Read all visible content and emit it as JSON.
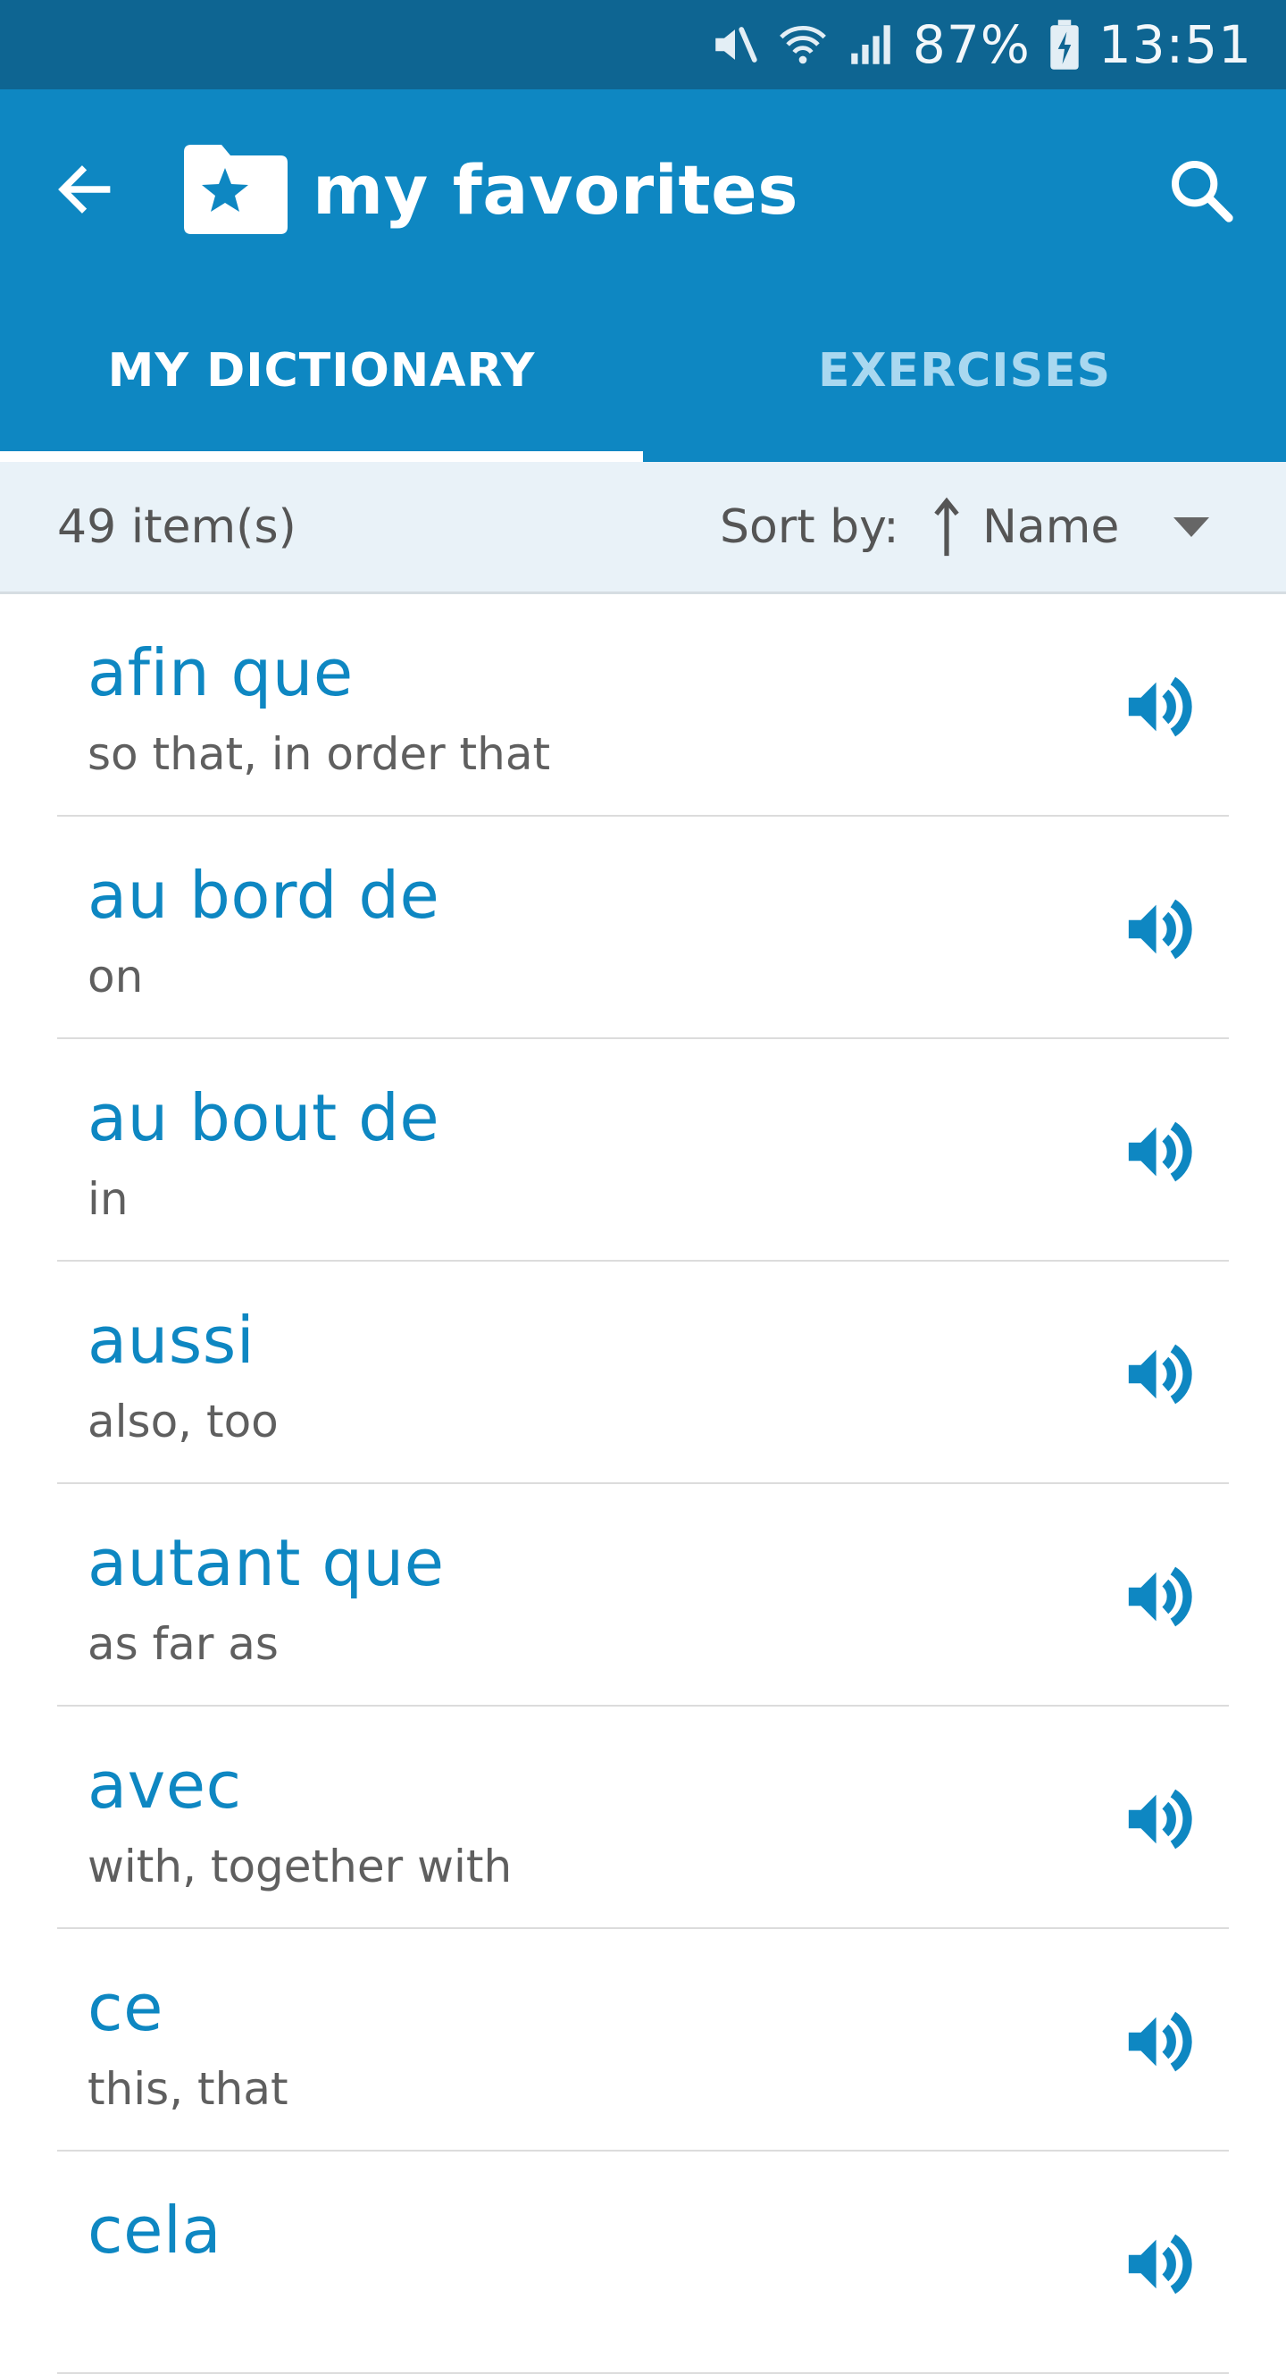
{
  "status_bar": {
    "battery": "87%",
    "time": "13:51",
    "icons": [
      "mute-icon",
      "wifi-icon",
      "signal-icon",
      "battery-charging-icon"
    ]
  },
  "toolbar": {
    "title": "my favorites",
    "back_icon": "arrow-left-icon",
    "logo_icon": "folder-star-icon",
    "search_icon": "search-icon"
  },
  "tabs": [
    {
      "label": "MY DICTIONARY",
      "active": true
    },
    {
      "label": "EXERCISES",
      "active": false
    }
  ],
  "sort_bar": {
    "item_count": "49 item(s)",
    "sort_label": "Sort by:",
    "sort_value": "Name",
    "sort_direction_icon": "arrow-up-icon",
    "dropdown_icon": "caret-down-icon"
  },
  "words": [
    {
      "term": "afin que",
      "translation": "so that, in order that"
    },
    {
      "term": "au bord de",
      "translation": "on"
    },
    {
      "term": "au bout de",
      "translation": "in"
    },
    {
      "term": "aussi",
      "translation": "also, too"
    },
    {
      "term": "autant que",
      "translation": "as far as"
    },
    {
      "term": "avec",
      "translation": "with, together with"
    },
    {
      "term": "ce",
      "translation": "this, that"
    },
    {
      "term": "cela",
      "translation": ""
    }
  ],
  "colors": {
    "status_bar": "#0e6592",
    "app_bar": "#0e87c2",
    "accent": "#0e87c2",
    "tab_inactive": "#a9d8f0",
    "sort_bar_bg": "#e9f2f8",
    "secondary_text": "#5f5f5f"
  }
}
